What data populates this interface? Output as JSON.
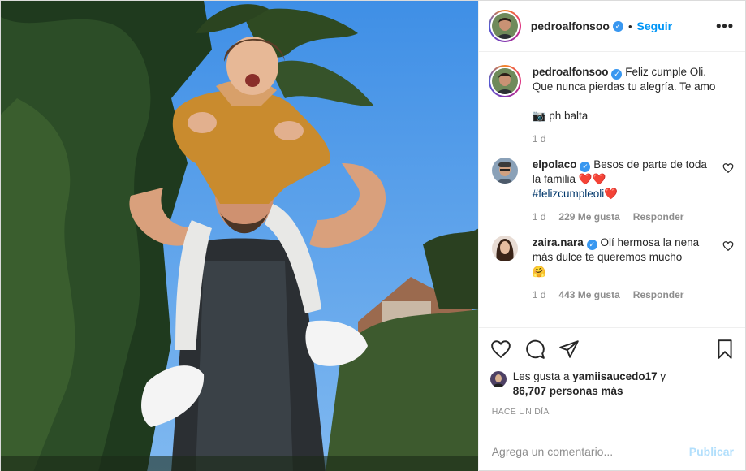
{
  "post": {
    "author": "pedroalfonsoo",
    "follow_label": "Seguir",
    "separator": "•",
    "more_label": "•••",
    "verified_mark": "✓",
    "caption_line1": "Feliz cumple Oli.",
    "caption_line2": "Que nunca pierdas tu alegría. Te amo",
    "caption_credit": "📷 ph balta",
    "caption_time": "1 d"
  },
  "comments": [
    {
      "user": "elpolaco",
      "text": "Besos de parte de toda la familia",
      "emoji": "❤️❤️",
      "hashtag": "#felizcumpleoli",
      "hashtag_emoji": "❤️",
      "time": "1 d",
      "likes": "229 Me gusta",
      "reply": "Responder"
    },
    {
      "user": "zaira.nara",
      "text": "Olí hermosa la nena más dulce te queremos mucho",
      "emoji": "🤗",
      "time": "1 d",
      "likes": "443 Me gusta",
      "reply": "Responder"
    }
  ],
  "likes": {
    "prefix": "Les gusta a",
    "user": "yamiisaucedo17",
    "conj": "y",
    "count": "86,707 personas más"
  },
  "when": "HACE UN DÍA",
  "add_comment": {
    "placeholder": "Agrega un comentario...",
    "publish": "Publicar"
  },
  "icons": {
    "like": "heart-icon",
    "comment": "comment-icon",
    "share": "share-icon",
    "save": "bookmark-icon"
  },
  "colors": {
    "accent": "#0095f6",
    "verified": "#3897f0",
    "muted": "#8e8e8e",
    "heart": "#e0245e"
  }
}
